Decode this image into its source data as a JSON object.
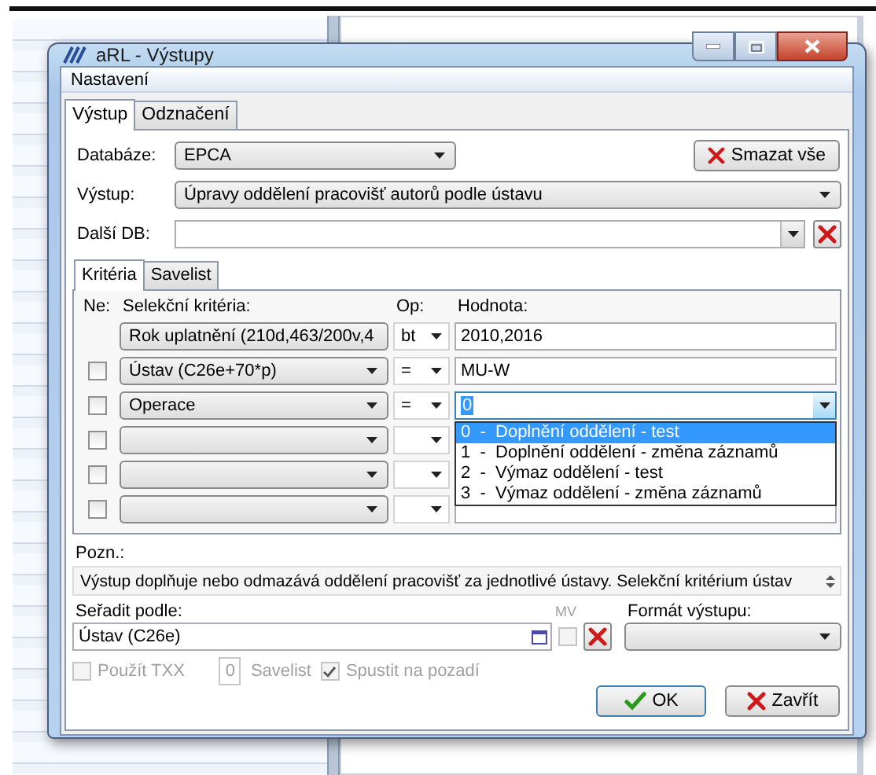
{
  "window": {
    "title": "aRL - Výstupy"
  },
  "menu": [
    "Nastavení"
  ],
  "tabs": [
    {
      "label": "Výstup",
      "selected": true
    },
    {
      "label": "Odznačení",
      "selected": false
    }
  ],
  "database": {
    "label": "Databáze:",
    "value": "EPCA"
  },
  "clear_all_button": "Smazat vše",
  "output": {
    "label": "Výstup:",
    "value": "Úpravy oddělení pracovišť autorů podle ústavu"
  },
  "other_db": {
    "label": "Další DB:"
  },
  "criteria_tabs": [
    {
      "label": "Kritéria",
      "selected": true
    },
    {
      "label": "Savelist",
      "selected": false
    }
  ],
  "criteria": {
    "headers": {
      "negate": "Ne:",
      "criterion": "Selekční kritéria:",
      "op": "Op:",
      "value": "Hodnota:"
    },
    "rows": [
      {
        "kind": "fixed",
        "criterion": "Rok uplatnění (210d,463/200v,4",
        "op": "bt",
        "value": "2010,2016",
        "expanded": false
      },
      {
        "kind": "optional",
        "negated": false,
        "criterion": "Ústav (C26e+70*p)",
        "op": "=",
        "value": "MU-W",
        "expanded": false
      },
      {
        "kind": "optional",
        "negated": false,
        "criterion": "Operace",
        "op": "=",
        "value": "0",
        "expanded": true,
        "options": [
          {
            "label": "0  -  Doplnění oddělení - test",
            "selected": true
          },
          {
            "label": "1  -  Doplnění oddělení - změna záznamů",
            "selected": false
          },
          {
            "label": "2  -  Výmaz oddělení - test",
            "selected": false
          },
          {
            "label": "3  -  Výmaz oddělení - změna záznamů",
            "selected": false
          }
        ]
      },
      {
        "kind": "optional",
        "negated": false
      },
      {
        "kind": "optional",
        "negated": false
      },
      {
        "kind": "optional",
        "negated": false
      }
    ]
  },
  "note": {
    "label": "Pozn.:",
    "text": "Výstup doplňuje nebo odmazává oddělení pracovišť za jednotlivé ústavy. Selekční kritérium ústav"
  },
  "sort": {
    "label": "Seřadit podle:",
    "value": "Ústav (C26e)"
  },
  "mv": {
    "label": "MV",
    "checked": false,
    "disabled": true
  },
  "format": {
    "label": "Formát výstupu:"
  },
  "options": {
    "use_txx": {
      "label": "Použít TXX",
      "checked": false,
      "disabled": true
    },
    "savelist_count": "0",
    "savelist_label": "Savelist",
    "run_background": {
      "label": "Spustit na pozadí",
      "checked": true,
      "disabled": true
    }
  },
  "buttons": [
    {
      "kind": "ok",
      "label": "OK"
    },
    {
      "kind": "close",
      "label": "Zavřít"
    }
  ]
}
